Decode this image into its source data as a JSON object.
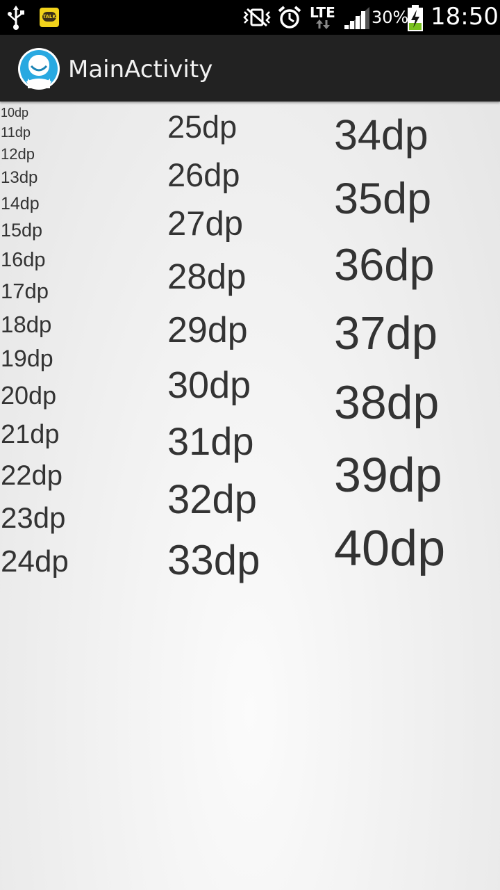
{
  "status_bar": {
    "battery_percent": "30%",
    "time": "18:50",
    "network": "LTE",
    "notification_icons": [
      "usb-icon",
      "kakaotalk-icon"
    ],
    "system_icons": [
      "vibrate-icon",
      "alarm-icon",
      "lte-icon",
      "signal-icon",
      "battery-charging-icon"
    ],
    "kakaotalk_label": "TALK"
  },
  "action_bar": {
    "title": "MainActivity",
    "icon": "app-launcher-icon"
  },
  "columns": [
    [
      "10dp",
      "11dp",
      "12dp",
      "13dp",
      "14dp",
      "15dp",
      "16dp",
      "17dp",
      "18dp",
      "19dp",
      "20dp",
      "21dp",
      "22dp",
      "23dp",
      "24dp"
    ],
    [
      "25dp",
      "26dp",
      "27dp",
      "28dp",
      "29dp",
      "30dp",
      "31dp",
      "32dp",
      "33dp"
    ],
    [
      "34dp",
      "35dp",
      "36dp",
      "37dp",
      "38dp",
      "39dp",
      "40dp"
    ]
  ]
}
